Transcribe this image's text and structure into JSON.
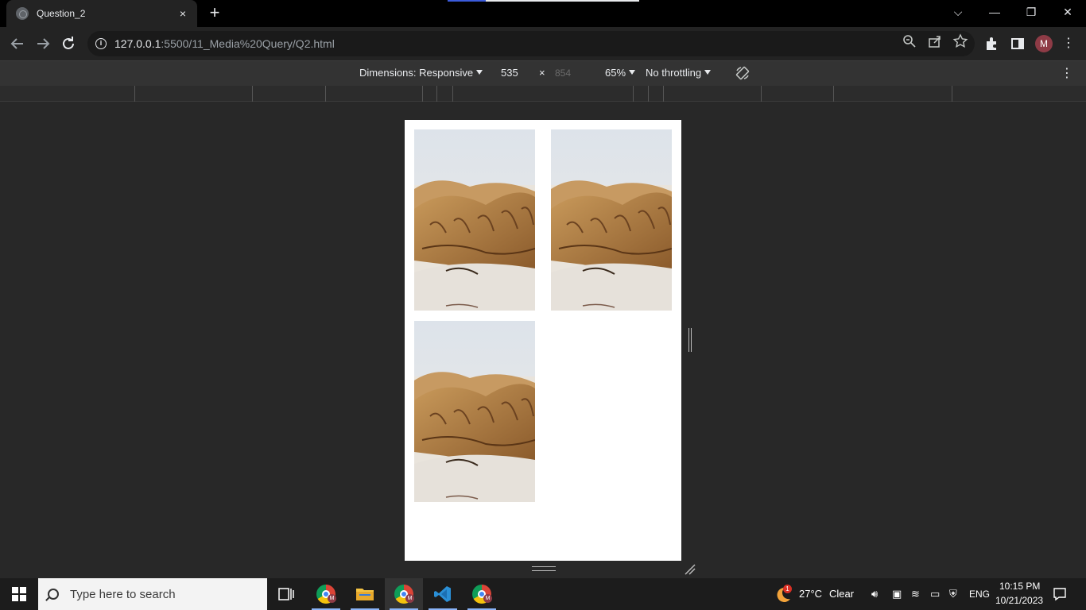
{
  "browser": {
    "tab_title": "Question_2",
    "tab_close": "×",
    "new_tab": "+",
    "url_host": "127.0.0.1",
    "url_rest": ":5500/11_Media%20Query/Q2.html",
    "profile_initial": "M"
  },
  "window_controls": {
    "dropdown": "⌵",
    "minimize": "—",
    "restore": "❐",
    "close": "✕"
  },
  "device_toolbar": {
    "dimensions_label": "Dimensions: Responsive",
    "width": "535",
    "times": "×",
    "height": "854",
    "zoom": "65%",
    "throttling": "No throttling"
  },
  "page_images": [
    {
      "alt": "walrus photo"
    },
    {
      "alt": "walrus photo"
    },
    {
      "alt": "walrus photo"
    }
  ],
  "taskbar": {
    "search_placeholder": "Type here to search",
    "weather_temp": "27°C",
    "weather_text": "Clear",
    "weather_badge": "1",
    "language": "ENG",
    "time": "10:15 PM",
    "date": "10/21/2023"
  },
  "colors": {
    "devtools_bg": "#282828",
    "viewport_bg": "#ffffff",
    "accent": "#8ab4f8"
  }
}
